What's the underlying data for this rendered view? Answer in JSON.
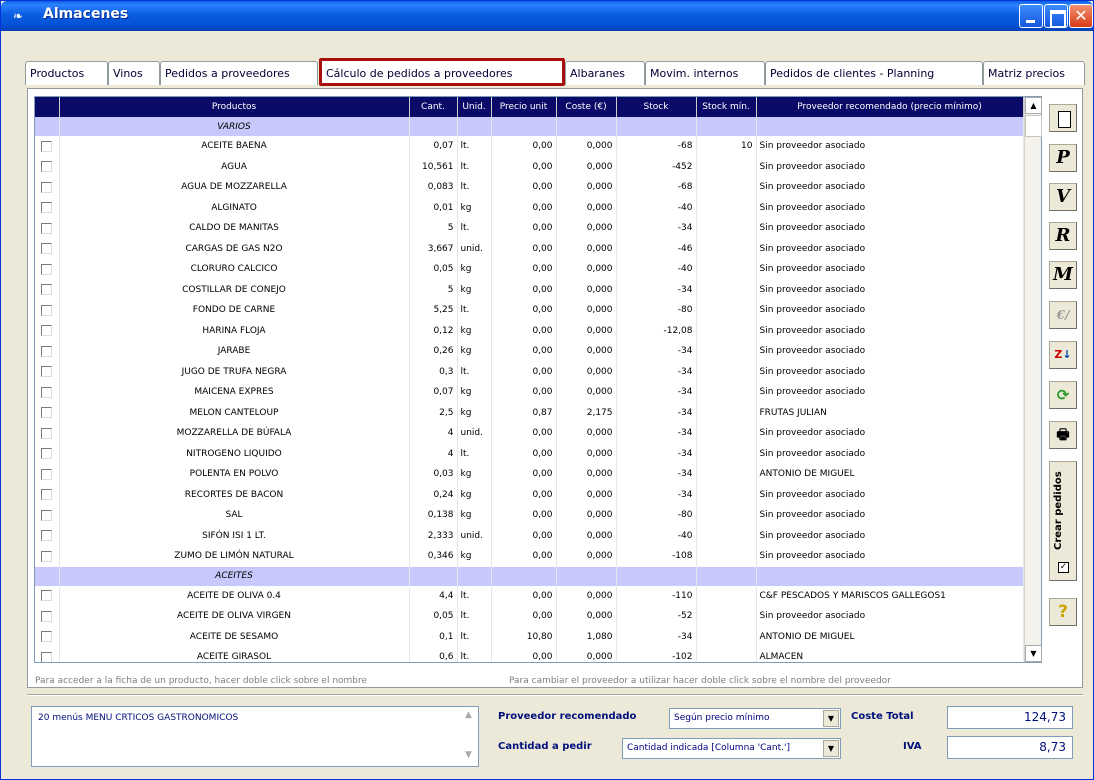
{
  "window": {
    "title": "Almacenes"
  },
  "tabs": [
    {
      "label": "Productos"
    },
    {
      "label": "Vinos"
    },
    {
      "label": "Pedidos a proveedores"
    },
    {
      "label": "Cálculo de pedidos a proveedores"
    },
    {
      "label": "Albaranes"
    },
    {
      "label": "Movim. internos"
    },
    {
      "label": "Pedidos de clientes - Planning"
    },
    {
      "label": "Matriz precios"
    }
  ],
  "grid": {
    "columns": {
      "productos": "Productos",
      "cant": "Cant.",
      "unid": "Unid.",
      "precio": "Precio unit",
      "coste": "Coste (€)",
      "stock": "Stock",
      "stock_min": "Stock mín.",
      "proveedor": "Proveedor recomendado (precio mínimo)"
    },
    "rows": [
      {
        "section": true,
        "name": "VARIOS"
      },
      {
        "name": "ACEITE BAENA",
        "cant": "0,07",
        "unid": "lt.",
        "precio": "0,00",
        "coste": "0,000",
        "stock": "-68",
        "stock_min": "10",
        "proveedor": "Sin proveedor asociado"
      },
      {
        "name": "AGUA",
        "cant": "10,561",
        "unid": "lt.",
        "precio": "0,00",
        "coste": "0,000",
        "stock": "-452",
        "stock_min": "",
        "proveedor": "Sin proveedor asociado"
      },
      {
        "name": "AGUA DE MOZZARELLA",
        "cant": "0,083",
        "unid": "lt.",
        "precio": "0,00",
        "coste": "0,000",
        "stock": "-68",
        "stock_min": "",
        "proveedor": "Sin proveedor asociado"
      },
      {
        "name": "ALGINATO",
        "cant": "0,01",
        "unid": "kg",
        "precio": "0,00",
        "coste": "0,000",
        "stock": "-40",
        "stock_min": "",
        "proveedor": "Sin proveedor asociado"
      },
      {
        "name": "CALDO DE MANITAS",
        "cant": "5",
        "unid": "lt.",
        "precio": "0,00",
        "coste": "0,000",
        "stock": "-34",
        "stock_min": "",
        "proveedor": "Sin proveedor asociado"
      },
      {
        "name": "CARGAS DE GAS N2O",
        "cant": "3,667",
        "unid": "unid.",
        "precio": "0,00",
        "coste": "0,000",
        "stock": "-46",
        "stock_min": "",
        "proveedor": "Sin proveedor asociado"
      },
      {
        "name": "CLORURO CALCICO",
        "cant": "0,05",
        "unid": "kg",
        "precio": "0,00",
        "coste": "0,000",
        "stock": "-40",
        "stock_min": "",
        "proveedor": "Sin proveedor asociado"
      },
      {
        "name": "COSTILLAR DE CONEJO",
        "cant": "5",
        "unid": "kg",
        "precio": "0,00",
        "coste": "0,000",
        "stock": "-34",
        "stock_min": "",
        "proveedor": "Sin proveedor asociado"
      },
      {
        "name": "FONDO DE CARNE",
        "cant": "5,25",
        "unid": "lt.",
        "precio": "0,00",
        "coste": "0,000",
        "stock": "-80",
        "stock_min": "",
        "proveedor": "Sin proveedor asociado"
      },
      {
        "name": "HARINA FLOJA",
        "cant": "0,12",
        "unid": "kg",
        "precio": "0,00",
        "coste": "0,000",
        "stock": "-12,08",
        "stock_min": "",
        "proveedor": "Sin proveedor asociado"
      },
      {
        "name": "JARABE",
        "cant": "0,26",
        "unid": "kg",
        "precio": "0,00",
        "coste": "0,000",
        "stock": "-34",
        "stock_min": "",
        "proveedor": "Sin proveedor asociado"
      },
      {
        "name": "JUGO DE TRUFA NEGRA",
        "cant": "0,3",
        "unid": "lt.",
        "precio": "0,00",
        "coste": "0,000",
        "stock": "-34",
        "stock_min": "",
        "proveedor": "Sin proveedor asociado"
      },
      {
        "name": "MAICENA EXPRES",
        "cant": "0,07",
        "unid": "kg",
        "precio": "0,00",
        "coste": "0,000",
        "stock": "-34",
        "stock_min": "",
        "proveedor": "Sin proveedor asociado"
      },
      {
        "name": "MELON CANTELOUP",
        "cant": "2,5",
        "unid": "kg",
        "precio": "0,87",
        "coste": "2,175",
        "stock": "-34",
        "stock_min": "",
        "proveedor": "FRUTAS JULIAN"
      },
      {
        "name": "MOZZARELLA DE BÚFALA",
        "cant": "4",
        "unid": "unid.",
        "precio": "0,00",
        "coste": "0,000",
        "stock": "-34",
        "stock_min": "",
        "proveedor": "Sin proveedor asociado"
      },
      {
        "name": "NITROGENO LIQUIDO",
        "cant": "4",
        "unid": "lt.",
        "precio": "0,00",
        "coste": "0,000",
        "stock": "-34",
        "stock_min": "",
        "proveedor": "Sin proveedor asociado"
      },
      {
        "name": "POLENTA EN POLVO",
        "cant": "0,03",
        "unid": "kg",
        "precio": "0,00",
        "coste": "0,000",
        "stock": "-34",
        "stock_min": "",
        "proveedor": "ANTONIO DE MIGUEL"
      },
      {
        "name": "RECORTES DE BACON",
        "cant": "0,24",
        "unid": "kg",
        "precio": "0,00",
        "coste": "0,000",
        "stock": "-34",
        "stock_min": "",
        "proveedor": "Sin proveedor asociado"
      },
      {
        "name": "SAL",
        "cant": "0,138",
        "unid": "kg",
        "precio": "0,00",
        "coste": "0,000",
        "stock": "-80",
        "stock_min": "",
        "proveedor": "Sin proveedor asociado"
      },
      {
        "name": "SIFÓN ISI 1 LT.",
        "cant": "2,333",
        "unid": "unid.",
        "precio": "0,00",
        "coste": "0,000",
        "stock": "-40",
        "stock_min": "",
        "proveedor": "Sin proveedor asociado"
      },
      {
        "name": "ZUMO DE LIMÓN NATURAL",
        "cant": "0,346",
        "unid": "kg",
        "precio": "0,00",
        "coste": "0,000",
        "stock": "-108",
        "stock_min": "",
        "proveedor": "Sin proveedor asociado"
      },
      {
        "section": true,
        "name": "ACEITES"
      },
      {
        "name": "ACEITE DE OLIVA 0.4",
        "cant": "4,4",
        "unid": "lt.",
        "precio": "0,00",
        "coste": "0,000",
        "stock": "-110",
        "stock_min": "",
        "proveedor": "C&F PESCADOS Y MARISCOS GALLEGOS1"
      },
      {
        "name": "ACEITE DE OLIVA VIRGEN",
        "cant": "0,05",
        "unid": "lt.",
        "precio": "0,00",
        "coste": "0,000",
        "stock": "-52",
        "stock_min": "",
        "proveedor": "Sin proveedor asociado"
      },
      {
        "name": "ACEITE DE SESAMO",
        "cant": "0,1",
        "unid": "lt.",
        "precio": "10,80",
        "coste": "1,080",
        "stock": "-34",
        "stock_min": "",
        "proveedor": "ANTONIO DE MIGUEL"
      },
      {
        "name": "ACEITE GIRASOL",
        "cant": "0,6",
        "unid": "lt.",
        "precio": "0,00",
        "coste": "0,000",
        "stock": "-102",
        "stock_min": "",
        "proveedor": "ALMACEN"
      }
    ]
  },
  "hints": {
    "left": "Para acceder a la ficha de un producto, hacer doble click sobre el nombre",
    "right": "Para cambiar el proveedor a utilizar hacer doble click sobre el nombre del proveedor"
  },
  "toolbar": {
    "p_label": "P",
    "v_label": "V",
    "r_label": "R",
    "m_label": "M",
    "crear_pedidos": "Crear pedidos"
  },
  "footer": {
    "notes": "20 menús MENU CRTICOS GASTRONOMICOS",
    "proveedor_label": "Proveedor recomendado",
    "proveedor_value": "Según precio mínimo",
    "cantidad_label": "Cantidad a pedir",
    "cantidad_value": "Cantidad indicada [Columna 'Cant.']",
    "coste_label": "Coste Total",
    "coste_value": "124,73",
    "iva_label": "IVA",
    "iva_value": "8,73"
  }
}
